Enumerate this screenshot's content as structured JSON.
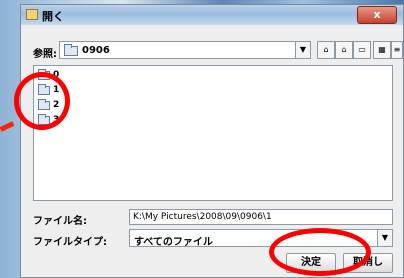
{
  "window": {
    "title": "開く",
    "close_symbol": "x"
  },
  "look_in": {
    "label": "参照:",
    "value": "0906"
  },
  "toolbar": {
    "icons": [
      "up-folder-icon",
      "home-icon",
      "new-folder-icon",
      "list-view-icon",
      "details-view-icon"
    ]
  },
  "files": [
    {
      "name": "0"
    },
    {
      "name": "1"
    },
    {
      "name": "2"
    },
    {
      "name": "3"
    }
  ],
  "filename": {
    "label": "ファイル名:",
    "value": "K:\\My Pictures\\2008\\09\\0906\\1"
  },
  "filetype": {
    "label": "ファイルタイプ:",
    "value": "すべてのファイル"
  },
  "buttons": {
    "ok": "決定",
    "cancel": "取消し"
  },
  "annotation_color": "#ff0000"
}
